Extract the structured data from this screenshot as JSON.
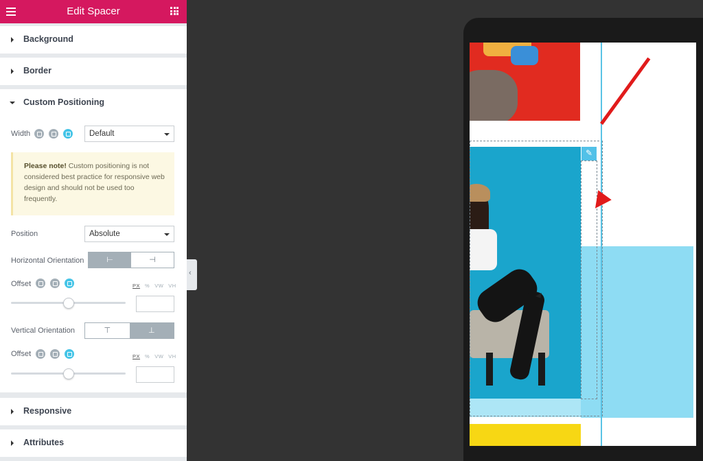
{
  "topbar": {
    "title": "Edit Spacer",
    "menu_icon": "hamburger-icon",
    "apps_icon": "grid-icon"
  },
  "sections": {
    "background": "Background",
    "border": "Border",
    "custom_positioning": "Custom Positioning",
    "responsive": "Responsive",
    "attributes": "Attributes"
  },
  "custom_positioning": {
    "width_label": "Width",
    "width_value": "Default",
    "note_bold": "Please note!",
    "note_text": " Custom positioning is not considered best practice for responsive web design and should not be used too frequently.",
    "position_label": "Position",
    "position_value": "Absolute",
    "horizontal_label": "Horizontal Orientation",
    "horizontal_options": [
      "⊢",
      "⊣"
    ],
    "horizontal_selected": 0,
    "offset_label": "Offset",
    "units": [
      "PX",
      "%",
      "VW",
      "VH"
    ],
    "offset_h_slider": 0.5,
    "vertical_label": "Vertical Orientation",
    "vertical_options": [
      "⊤",
      "⊥"
    ],
    "vertical_selected": 1,
    "offset_v_slider": 0.5
  },
  "preview": {
    "accent": "#59c3e5",
    "annotation_arrow_color": "#e11b1b",
    "edit_icon": "pencil-icon"
  },
  "colors": {
    "topbar": "#d5185f",
    "device_active": "#44c4e7"
  }
}
